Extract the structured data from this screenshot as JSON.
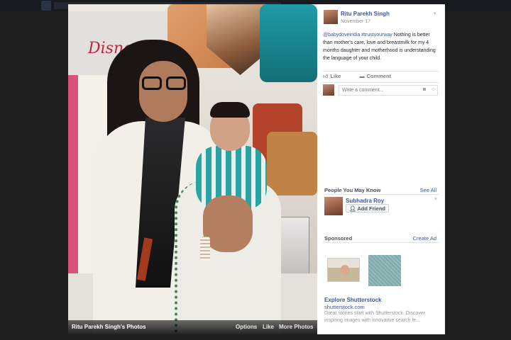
{
  "photo": {
    "owner_label": "Ritu Parekh Singh's Photos",
    "options_label": "Options",
    "like_label": "Like",
    "more_photos_label": "More Photos",
    "sign_text": "Disney"
  },
  "post": {
    "author": "Ritu Parekh Singh",
    "timestamp": "November 17",
    "hashtag1": "@babydoveindia",
    "hashtag2": "#trustyourway",
    "body": " Nothing is better than mother's care, love and breastmilk for my 4 months daughter and motherhood is understanding the language of your child.",
    "like_label": "Like",
    "comment_label": "Comment",
    "comment_placeholder": "Write a comment..."
  },
  "people_you_may_know": {
    "heading": "People You May Know",
    "see_all": "See All",
    "person_name": "Subhadra Roy",
    "add_friend_label": "Add Friend",
    "close_symbol": "×"
  },
  "sponsored": {
    "heading": "Sponsored",
    "create_ad": "Create Ad",
    "ad_title": "Explore Shutterstock",
    "ad_url": "shutterstock.com",
    "ad_desc": "Great stories start with Shutterstock. Discover inspiring images with innovative search fe..."
  },
  "icons": {
    "like": "thumbs-up-icon",
    "comment": "comment-icon",
    "camera": "camera-icon",
    "emoji": "smile-icon",
    "add_friend": "add-friend-icon",
    "menu": "chevron-down-icon"
  },
  "colors": {
    "link": "#3b5998",
    "muted": "#90949c",
    "backdrop": "#1f1f1f"
  }
}
